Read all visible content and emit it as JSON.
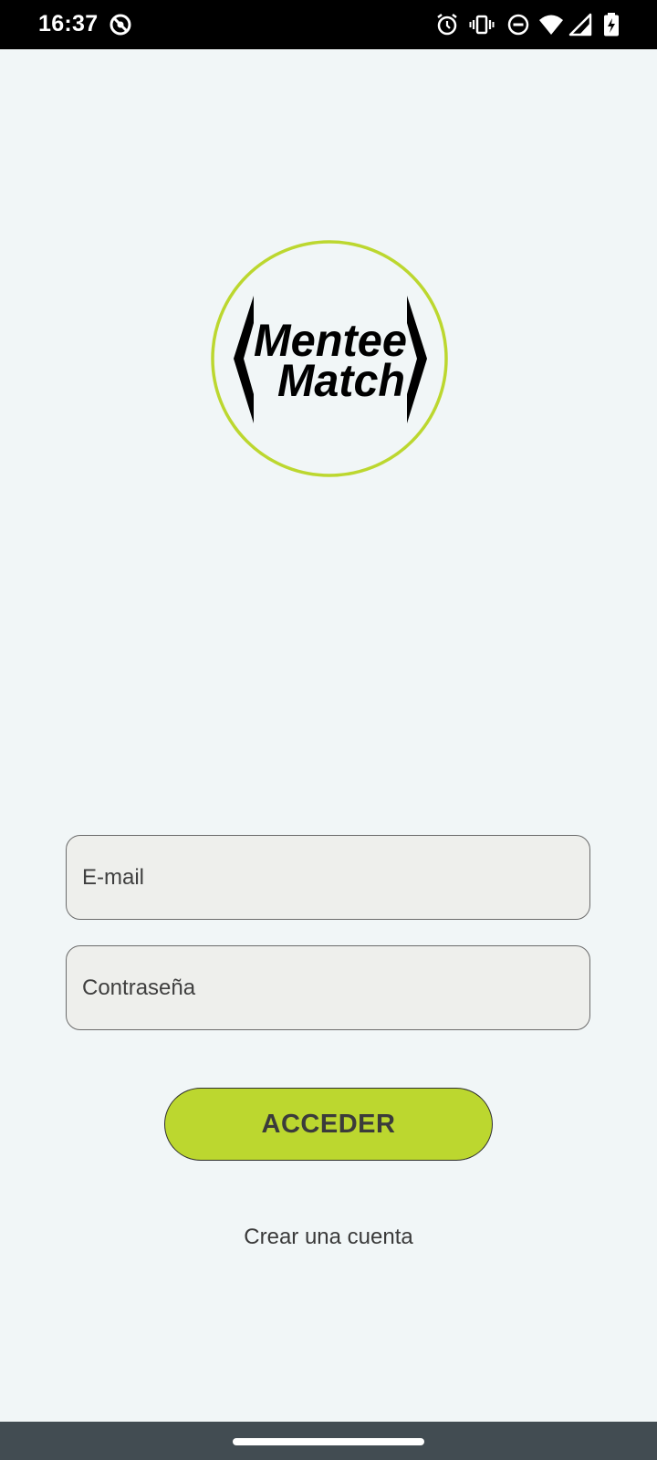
{
  "status_bar": {
    "time": "16:37",
    "icons": [
      "do-not-disturb-circle-icon",
      "alarm-icon",
      "vibrate-icon",
      "dnd-minus-icon",
      "wifi-icon",
      "signal-icon",
      "battery-charging-icon"
    ]
  },
  "logo": {
    "line1": "Mentee",
    "line2": "Match",
    "ring_color": "#bcd72f"
  },
  "form": {
    "email_placeholder": "E-mail",
    "password_placeholder": "Contraseña",
    "login_label": "ACCEDER",
    "create_account_label": "Crear una cuenta"
  },
  "colors": {
    "accent": "#bcd72f",
    "background": "#f1f6f7",
    "field_background": "#eeefec",
    "nav_bar": "#424c52"
  }
}
